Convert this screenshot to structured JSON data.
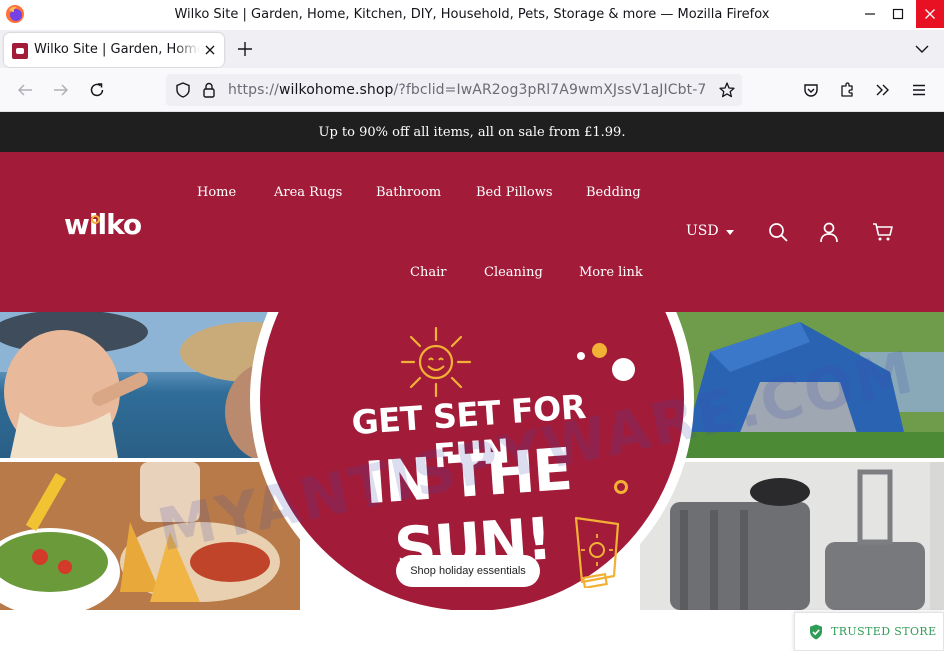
{
  "window": {
    "title": "Wilko Site | Garden, Home, Kitchen, DIY, Household, Pets, Storage & more — Mozilla Firefox"
  },
  "tabs": [
    {
      "label": "Wilko Site | Garden, Home, Kitchen, DIY, Household, Pets, Storage & more",
      "active": true
    }
  ],
  "urlbar": {
    "scheme": "https://",
    "domain": "wilkohome.shop",
    "path": "/?fbclid=IwAR2og3pRl7A9wmXJssV1aJICbt-7"
  },
  "announcement": "Up to 90% off all items, all on sale from £1.99.",
  "header": {
    "logo_text": "wilko",
    "nav_row1": [
      "Home",
      "Area Rugs",
      "Bathroom",
      "Bed Pillows",
      "Bedding"
    ],
    "nav_row2": [
      "Chair",
      "Cleaning",
      "More link"
    ],
    "currency": "USD"
  },
  "hero": {
    "line1": "GET SET FOR FUN",
    "line2": "IN THE SUN!",
    "cta": "Shop holiday essentials"
  },
  "trust_badge": "TRUSTED STORE",
  "watermark": "MYANTISPYWARE.COM",
  "colors": {
    "brand": "#a21c3a",
    "announcement_bg": "#1f1f1f",
    "accent_yellow": "#f2b134",
    "trust_green": "#2f9d55"
  },
  "icons": {
    "browser": [
      "firefox-logo-icon",
      "back-arrow-icon",
      "forward-arrow-icon",
      "reload-icon",
      "tracking-shield-icon",
      "lock-icon",
      "bookmark-star-icon",
      "pocket-icon",
      "extensions-icon",
      "overflow-chevron-icon",
      "hamburger-menu-icon"
    ],
    "site": [
      "search-icon",
      "account-icon",
      "cart-icon",
      "shield-check-icon"
    ]
  }
}
